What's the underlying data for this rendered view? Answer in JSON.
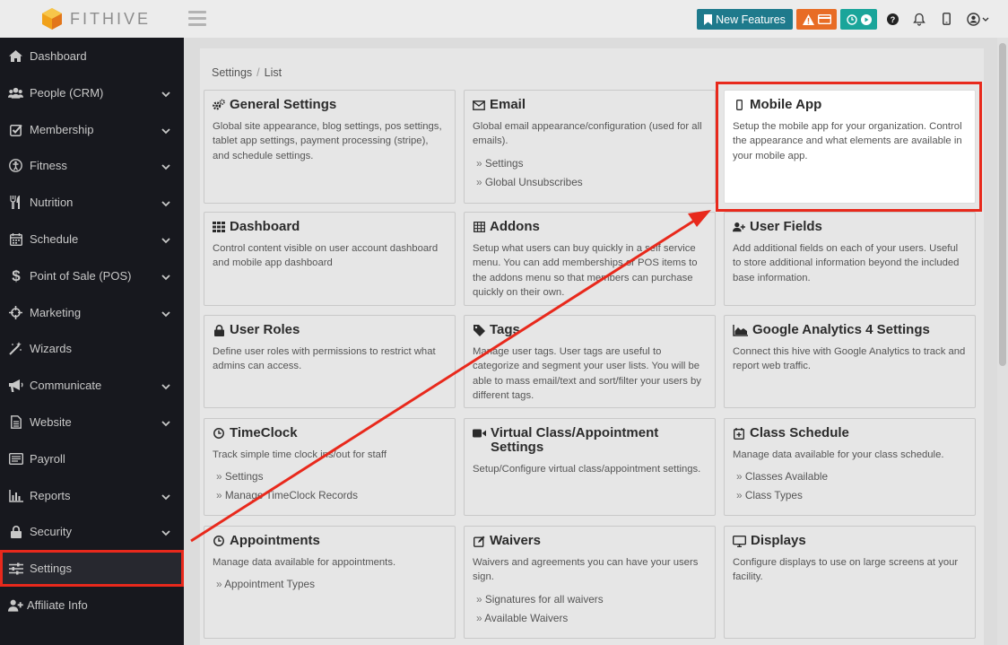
{
  "app": {
    "name": "FITHIVE"
  },
  "topbar": {
    "new_features": "New Features",
    "icons": [
      "bookmark-icon",
      "warning-icon",
      "card-icon",
      "clock-icon",
      "play-icon",
      "help-icon",
      "bell-icon",
      "mobile-icon",
      "user-icon"
    ]
  },
  "sidebar": {
    "items": [
      {
        "label": "Dashboard",
        "icon": "home-icon",
        "chevron": false
      },
      {
        "label": "People (CRM)",
        "icon": "users-icon",
        "chevron": true
      },
      {
        "label": "Membership",
        "icon": "check-square-icon",
        "chevron": true
      },
      {
        "label": "Fitness",
        "icon": "fitness-icon",
        "chevron": true
      },
      {
        "label": "Nutrition",
        "icon": "utensils-icon",
        "chevron": true
      },
      {
        "label": "Schedule",
        "icon": "calendar-icon",
        "chevron": true
      },
      {
        "label": "Point of Sale (POS)",
        "icon": "dollar-icon",
        "chevron": true
      },
      {
        "label": "Marketing",
        "icon": "crosshair-icon",
        "chevron": true
      },
      {
        "label": "Wizards",
        "icon": "wand-icon",
        "chevron": false
      },
      {
        "label": "Communicate",
        "icon": "megaphone-icon",
        "chevron": true
      },
      {
        "label": "Website",
        "icon": "file-icon",
        "chevron": true
      },
      {
        "label": "Payroll",
        "icon": "payroll-icon",
        "chevron": false
      },
      {
        "label": "Reports",
        "icon": "bar-chart-icon",
        "chevron": true
      },
      {
        "label": "Security",
        "icon": "lock-icon",
        "chevron": true
      },
      {
        "label": "Settings",
        "icon": "sliders-icon",
        "chevron": false
      },
      {
        "label": "Affiliate Info",
        "icon": "user-plus-icon",
        "chevron": false
      }
    ]
  },
  "breadcrumb": {
    "items": [
      "Settings",
      "List"
    ]
  },
  "cards": {
    "general": {
      "title": "General Settings",
      "desc": "Global site appearance, blog settings, pos settings, tablet app settings, payment processing (stripe), and schedule settings."
    },
    "email": {
      "title": "Email",
      "desc": "Global email appearance/configuration (used for all emails).",
      "links": [
        "Settings",
        "Global Unsubscribes"
      ]
    },
    "mobile": {
      "title": "Mobile App",
      "desc": "Setup the mobile app for your organization. Control the appearance and what elements are available in your mobile app."
    },
    "dashboard": {
      "title": "Dashboard",
      "desc": "Control content visible on user account dashboard and mobile app dashboard"
    },
    "addons": {
      "title": "Addons",
      "desc": "Setup what users can buy quickly in a self service menu. You can add memberships or POS items to the addons menu so that members can purchase quickly on their own."
    },
    "userfields": {
      "title": "User Fields",
      "desc": "Add additional fields on each of your users. Useful to store additional information beyond the included base information."
    },
    "userroles": {
      "title": "User Roles",
      "desc": "Define user roles with permissions to restrict what admins can access."
    },
    "tags": {
      "title": "Tags",
      "desc": "Manage user tags. User tags are useful to categorize and segment your user lists. You will be able to mass email/text and sort/filter your users by different tags."
    },
    "ga4": {
      "title": "Google Analytics 4 Settings",
      "desc": "Connect this hive with Google Analytics to track and report web traffic."
    },
    "timeclock": {
      "title": "TimeClock",
      "desc": "Track simple time clock ins/out for staff",
      "links": [
        "Settings",
        "Manage TimeClock Records"
      ]
    },
    "virtual": {
      "title": "Virtual Class/Appointment Settings",
      "desc": "Setup/Configure virtual class/appointment settings."
    },
    "classschedule": {
      "title": "Class Schedule",
      "desc": "Manage data available for your class schedule.",
      "links": [
        "Classes Available",
        "Class Types"
      ]
    },
    "appointments": {
      "title": "Appointments",
      "desc": "Manage data available for appointments.",
      "links": [
        "Appointment Types"
      ]
    },
    "waivers": {
      "title": "Waivers",
      "desc": "Waivers and agreements you can have your users sign.",
      "links": [
        "Signatures for all waivers",
        "Available Waivers"
      ]
    },
    "displays": {
      "title": "Displays",
      "desc": "Configure displays to use on large screens at your facility."
    }
  },
  "colors": {
    "highlight": "#e8291c",
    "sidebar_bg": "#17181e",
    "new_features": "#1e7a8c",
    "warn": "#e86c25",
    "clock": "#1aa59a"
  }
}
